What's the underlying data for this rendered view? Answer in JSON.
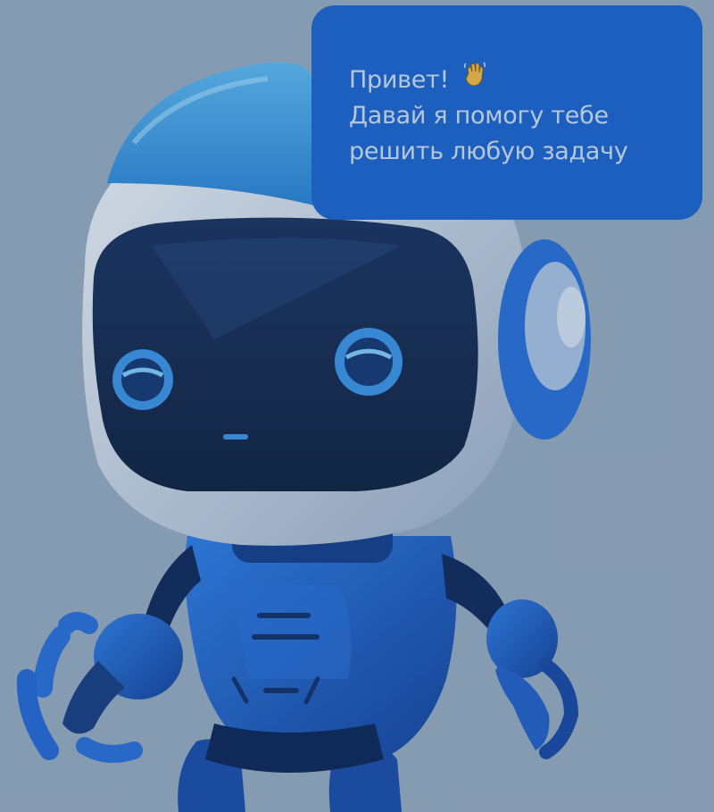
{
  "bubble": {
    "greeting": "Привет!",
    "line2": "Давай я помогу тебе",
    "line3": "решить любую задачу",
    "emoji": "waving-hand-icon"
  },
  "colors": {
    "background": "#8fa4bc",
    "bubble": "#1e63c9",
    "bubble_text": "#c5d4e8",
    "robot_body": "#1f5fc6",
    "robot_head": "#c9d5e4",
    "visor": "#172a4d",
    "eye_glow": "#3b8fe0"
  }
}
